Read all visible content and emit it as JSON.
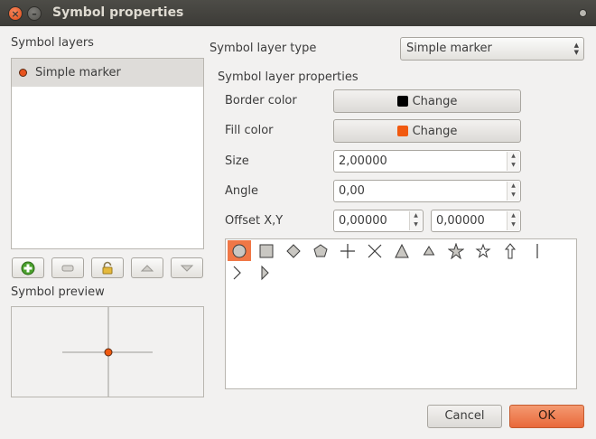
{
  "window": {
    "title": "Symbol properties"
  },
  "left": {
    "layers_label": "Symbol layers",
    "layers": [
      {
        "label": "Simple marker",
        "color": "#e8541f"
      }
    ],
    "preview_label": "Symbol preview",
    "toolbar": [
      "add-layer-icon",
      "remove-layer-icon",
      "lock-icon",
      "move-up-icon",
      "move-down-icon"
    ]
  },
  "right": {
    "type_label": "Symbol layer type",
    "type_value": "Simple marker",
    "props_label": "Symbol layer properties",
    "border_color_label": "Border color",
    "border_color_button": "Change",
    "border_color": "#000000",
    "fill_color_label": "Fill color",
    "fill_color_button": "Change",
    "fill_color": "#f1590f",
    "size_label": "Size",
    "size_value": "2,00000",
    "angle_label": "Angle",
    "angle_value": "0,00",
    "offset_label": "Offset X,Y",
    "offset_x": "0,00000",
    "offset_y": "0,00000",
    "markers": [
      "circle",
      "square",
      "diamond",
      "pentagon",
      "cross",
      "x",
      "triangle",
      "equilateral-triangle",
      "star",
      "regular-star",
      "arrow",
      "line",
      "arrowhead",
      "filled-arrowhead"
    ],
    "selected_marker": "circle"
  },
  "buttons": {
    "cancel": "Cancel",
    "ok": "OK"
  }
}
